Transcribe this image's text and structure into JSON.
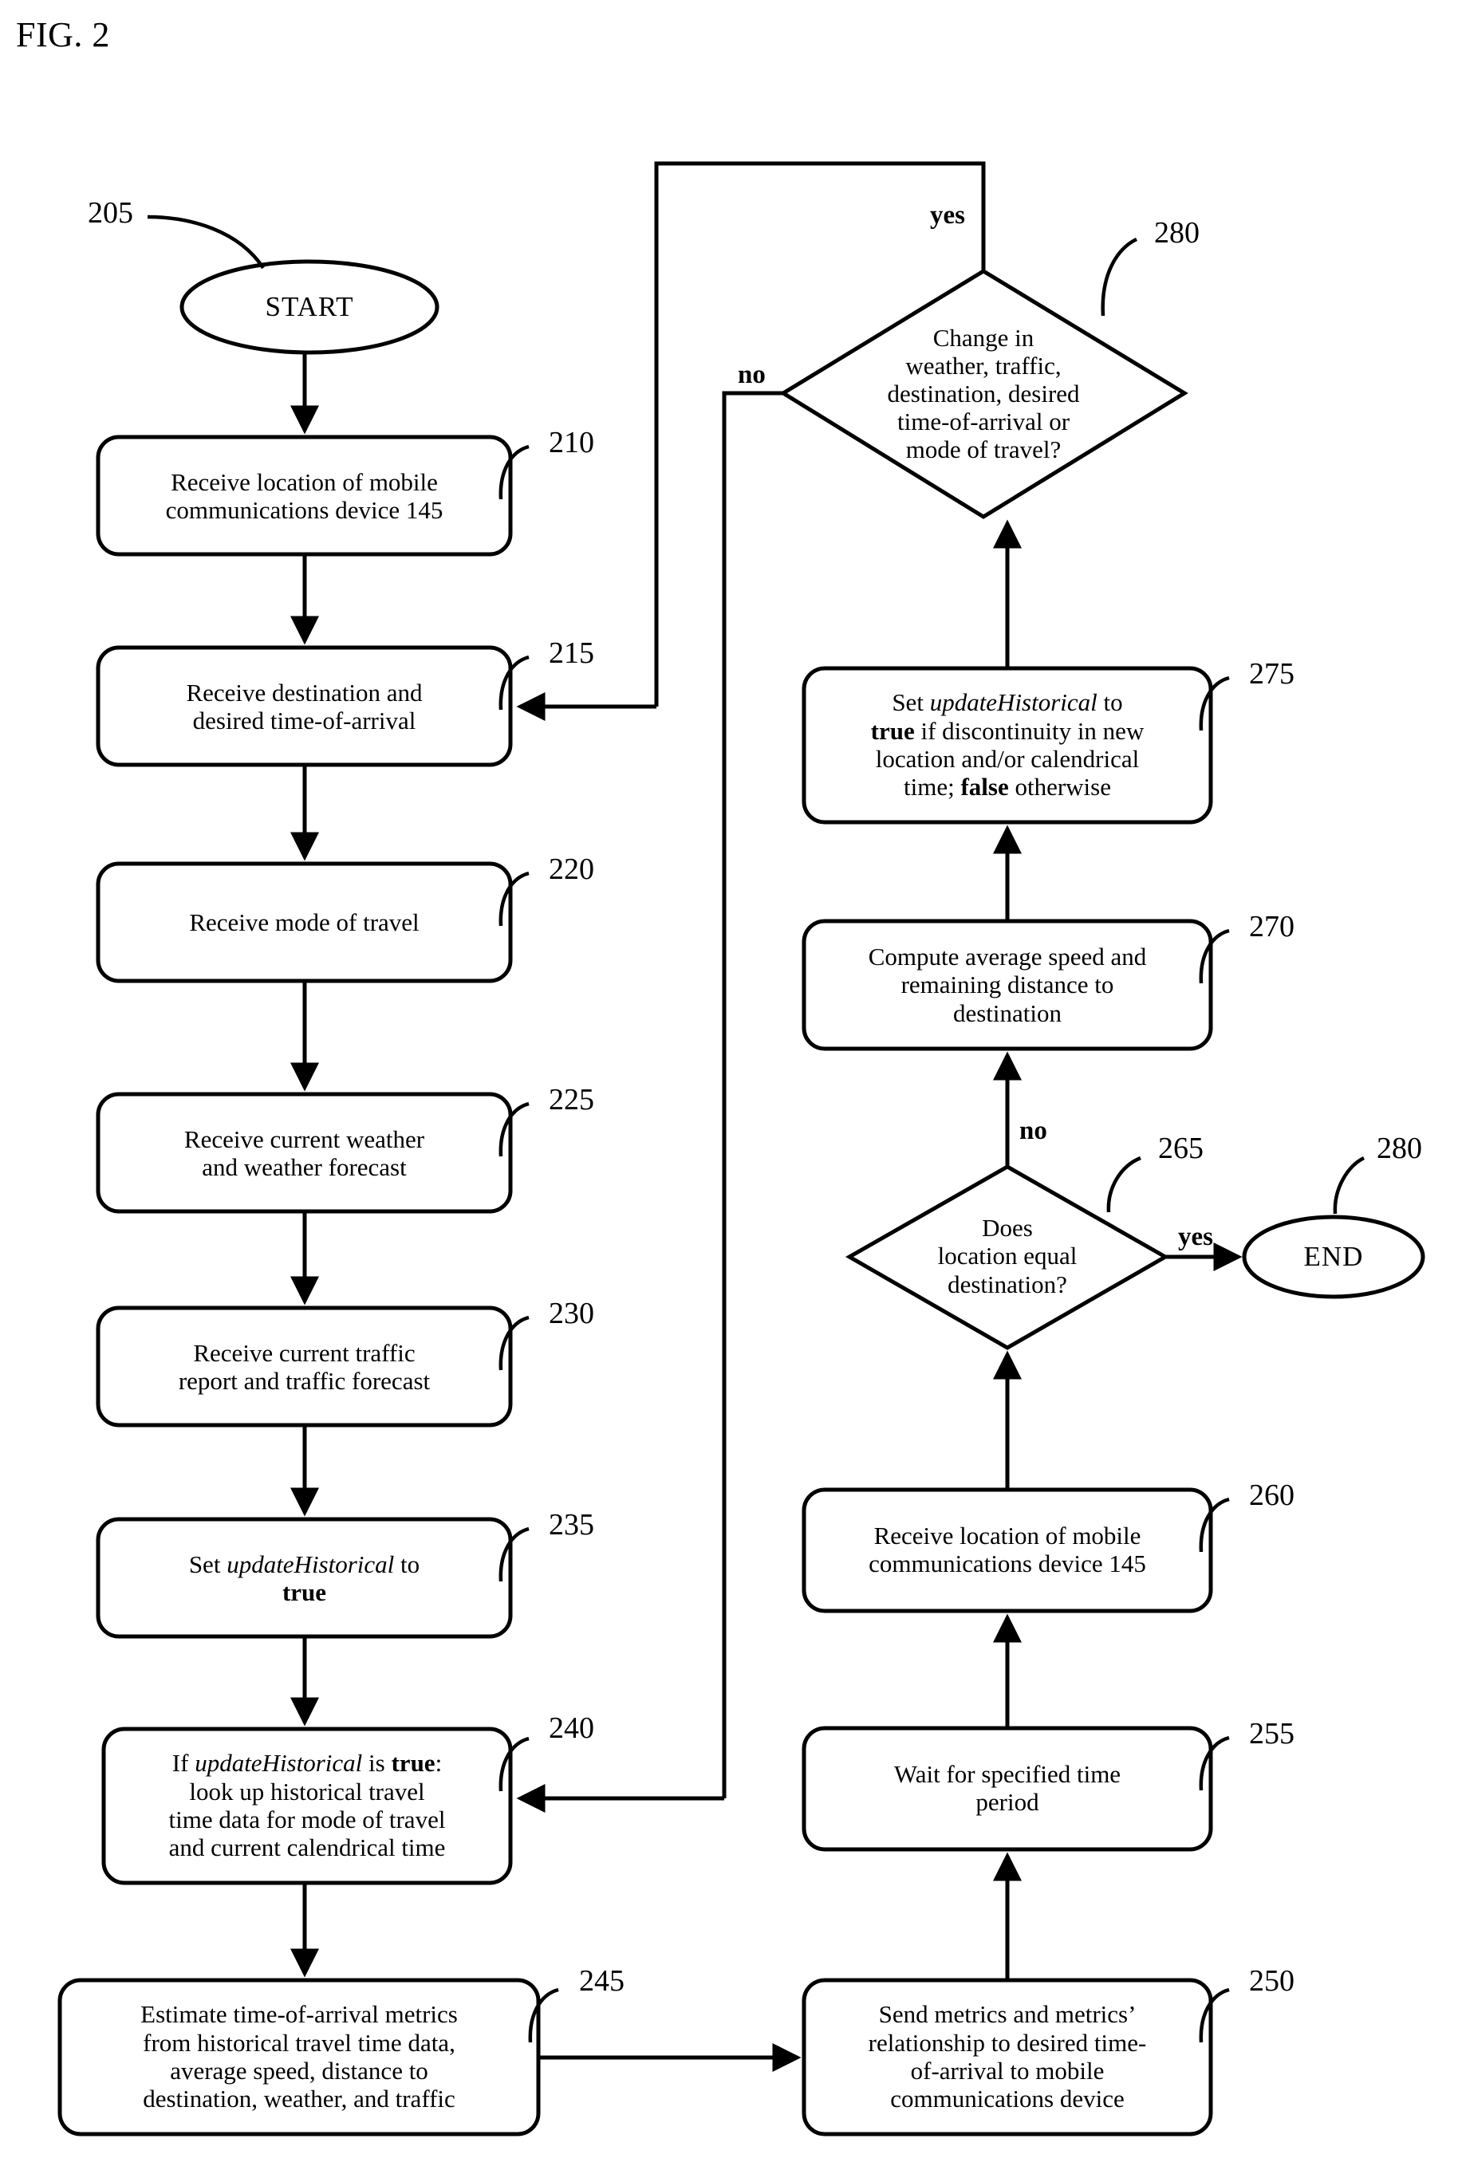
{
  "figure": {
    "label": "FIG. 2",
    "title": "FIG. 2"
  },
  "nodes": {
    "start": {
      "ref": "205",
      "type": "terminator",
      "text": "START"
    },
    "n210": {
      "ref": "210",
      "type": "process",
      "line1": "Receive location of mobile",
      "line2": "communications device 145"
    },
    "n215": {
      "ref": "215",
      "type": "process",
      "line1": "Receive destination and",
      "line2": "desired time-of-arrival"
    },
    "n220": {
      "ref": "220",
      "type": "process",
      "line1": "Receive mode of travel"
    },
    "n225": {
      "ref": "225",
      "type": "process",
      "line1": "Receive current weather",
      "line2": "and weather forecast"
    },
    "n230": {
      "ref": "230",
      "type": "process",
      "line1": "Receive current traffic",
      "line2": "report and traffic forecast"
    },
    "n235": {
      "ref": "235",
      "type": "process",
      "pre": "Set ",
      "italic": "updateHistorical",
      "mid": " to",
      "bold": "true"
    },
    "n240": {
      "ref": "240",
      "type": "process",
      "pre": "If ",
      "italic": "updateHistorical",
      "mid": " is ",
      "bold": "true",
      "post": ":",
      "line2": "look up historical travel",
      "line3": "time data for mode of travel",
      "line4": "and current calendrical time"
    },
    "n245": {
      "ref": "245",
      "type": "process",
      "line1": "Estimate time-of-arrival metrics",
      "line2": "from historical travel time data,",
      "line3": "average speed, distance to",
      "line4": "destination, weather, and traffic"
    },
    "n250": {
      "ref": "250",
      "type": "process",
      "line1": "Send metrics and metrics’",
      "line2": "relationship to desired time-",
      "line3": "of-arrival to mobile",
      "line4": "communications device"
    },
    "n255": {
      "ref": "255",
      "type": "process",
      "line1": "Wait for specified time",
      "line2": "period"
    },
    "n260": {
      "ref": "260",
      "type": "process",
      "line1": "Receive location of mobile",
      "line2": "communications device 145"
    },
    "n265": {
      "ref": "265",
      "type": "decision",
      "line1": "Does",
      "line2": "location equal",
      "line3": "destination?"
    },
    "n270": {
      "ref": "270",
      "type": "process",
      "line1": "Compute average speed and",
      "line2": "remaining distance to",
      "line3": "destination"
    },
    "n275": {
      "ref": "275",
      "type": "process",
      "pre": "Set ",
      "italic": "updateHistorical",
      "mid": " to",
      "bold1": "true",
      "seg2": " if discontinuity in new",
      "line3": "location and/or calendrical",
      "line4pre": "time; ",
      "bold2": "false",
      "line4post": " otherwise"
    },
    "n280": {
      "ref": "280",
      "type": "decision",
      "line1": "Change in",
      "line2": "weather, traffic,",
      "line3": "destination, desired",
      "line4": "time-of-arrival or",
      "line5": "mode of travel?"
    },
    "end": {
      "ref": "280",
      "type": "terminator",
      "text": "END"
    }
  },
  "edge_labels": {
    "d280_yes": "yes",
    "d280_no": "no",
    "d265_yes": "yes",
    "d265_no": "no"
  },
  "colors": {
    "stroke": "#000000",
    "background": "#ffffff"
  },
  "chart_data": {
    "type": "flowchart",
    "title": "FIG. 2",
    "orientation": "two-column",
    "steps": [
      {
        "id": "205",
        "shape": "ellipse",
        "label": "START"
      },
      {
        "id": "210",
        "shape": "rounded-rect",
        "label": "Receive location of mobile communications device 145"
      },
      {
        "id": "215",
        "shape": "rounded-rect",
        "label": "Receive destination and desired time-of-arrival"
      },
      {
        "id": "220",
        "shape": "rounded-rect",
        "label": "Receive mode of travel"
      },
      {
        "id": "225",
        "shape": "rounded-rect",
        "label": "Receive current weather and weather forecast"
      },
      {
        "id": "230",
        "shape": "rounded-rect",
        "label": "Receive current traffic report and traffic forecast"
      },
      {
        "id": "235",
        "shape": "rounded-rect",
        "label": "Set updateHistorical to true"
      },
      {
        "id": "240",
        "shape": "rounded-rect",
        "label": "If updateHistorical is true: look up historical travel time data for mode of travel and current calendrical time"
      },
      {
        "id": "245",
        "shape": "rounded-rect",
        "label": "Estimate time-of-arrival metrics from historical travel time data, average speed, distance to destination, weather, and traffic"
      },
      {
        "id": "250",
        "shape": "rounded-rect",
        "label": "Send metrics and metrics’ relationship to desired time-of-arrival to mobile communications device"
      },
      {
        "id": "255",
        "shape": "rounded-rect",
        "label": "Wait for specified time period"
      },
      {
        "id": "260",
        "shape": "rounded-rect",
        "label": "Receive location of mobile communications device 145"
      },
      {
        "id": "265",
        "shape": "diamond",
        "label": "Does location equal destination?"
      },
      {
        "id": "270",
        "shape": "rounded-rect",
        "label": "Compute average speed and remaining distance to destination"
      },
      {
        "id": "275",
        "shape": "rounded-rect",
        "label": "Set updateHistorical to true if discontinuity in new location and/or calendrical time; false otherwise"
      },
      {
        "id": "280d",
        "shape": "diamond",
        "label": "Change in weather, traffic, destination, desired time-of-arrival or mode of travel?"
      },
      {
        "id": "280e",
        "shape": "ellipse",
        "label": "END"
      }
    ],
    "edges": [
      {
        "from": "205",
        "to": "210"
      },
      {
        "from": "210",
        "to": "215"
      },
      {
        "from": "215",
        "to": "220"
      },
      {
        "from": "220",
        "to": "225"
      },
      {
        "from": "225",
        "to": "230"
      },
      {
        "from": "230",
        "to": "235"
      },
      {
        "from": "235",
        "to": "240"
      },
      {
        "from": "240",
        "to": "245"
      },
      {
        "from": "245",
        "to": "250"
      },
      {
        "from": "250",
        "to": "255"
      },
      {
        "from": "255",
        "to": "260"
      },
      {
        "from": "260",
        "to": "265"
      },
      {
        "from": "265",
        "to": "280e",
        "label": "yes"
      },
      {
        "from": "265",
        "to": "270",
        "label": "no"
      },
      {
        "from": "270",
        "to": "275"
      },
      {
        "from": "275",
        "to": "280d"
      },
      {
        "from": "280d",
        "to": "215",
        "label": "yes"
      },
      {
        "from": "280d",
        "to": "240",
        "label": "no"
      }
    ]
  }
}
